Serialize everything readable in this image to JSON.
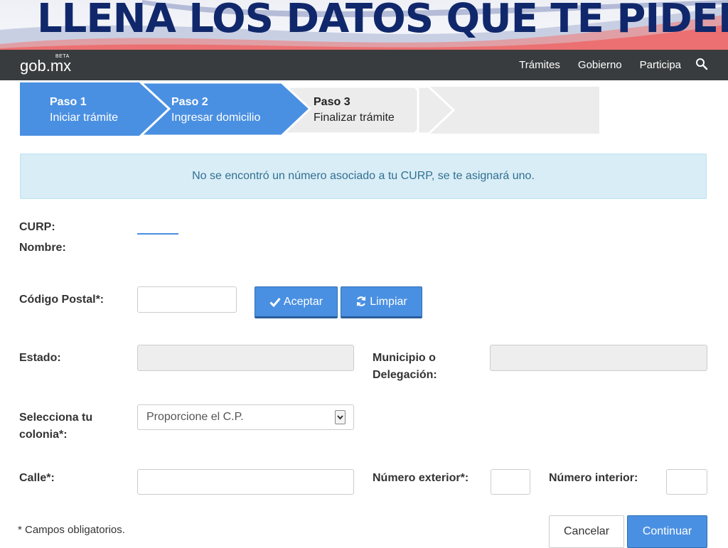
{
  "banner": {
    "title": "LLENA LOS DATOS QUE TE PIDEN"
  },
  "nav": {
    "logo": "gob.mx",
    "beta": "BETA",
    "links": [
      "Trámites",
      "Gobierno",
      "Participa"
    ]
  },
  "steps": [
    {
      "num": "Paso 1",
      "label": "Iniciar trámite",
      "state": "done"
    },
    {
      "num": "Paso 2",
      "label": "Ingresar domicilio",
      "state": "active"
    },
    {
      "num": "Paso 3",
      "label": "Finalizar trámite",
      "state": "pending"
    }
  ],
  "alert": "No se encontró un número asociado a tu CURP, se te asignará uno.",
  "form": {
    "curp_label": "CURP:",
    "nombre_label": "Nombre:",
    "cp_label": "Código Postal",
    "cp_value": "",
    "aceptar": "Aceptar",
    "limpiar": "Limpiar",
    "estado_label": "Estado:",
    "municipio_label_1": "Municipio o",
    "municipio_label_2": "Delegación:",
    "colonia_label_1": "Selecciona tu",
    "colonia_label_2": "colonia",
    "colonia_selected": "Proporcione el C.P.",
    "calle_label": "Calle",
    "num_ext_label": "Número exterior",
    "num_int_label": "Número interior:",
    "required_mark": "*",
    "footnote": "* Campos obligatorios."
  },
  "actions": {
    "cancel": "Cancelar",
    "continue": "Continuar"
  },
  "colors": {
    "navbar": "#393c3e",
    "step_active": "#4a90e2",
    "step_pending": "#ececec",
    "alert_bg": "#d9edf7",
    "alert_text": "#31708f",
    "banner_text": "#10286b"
  }
}
